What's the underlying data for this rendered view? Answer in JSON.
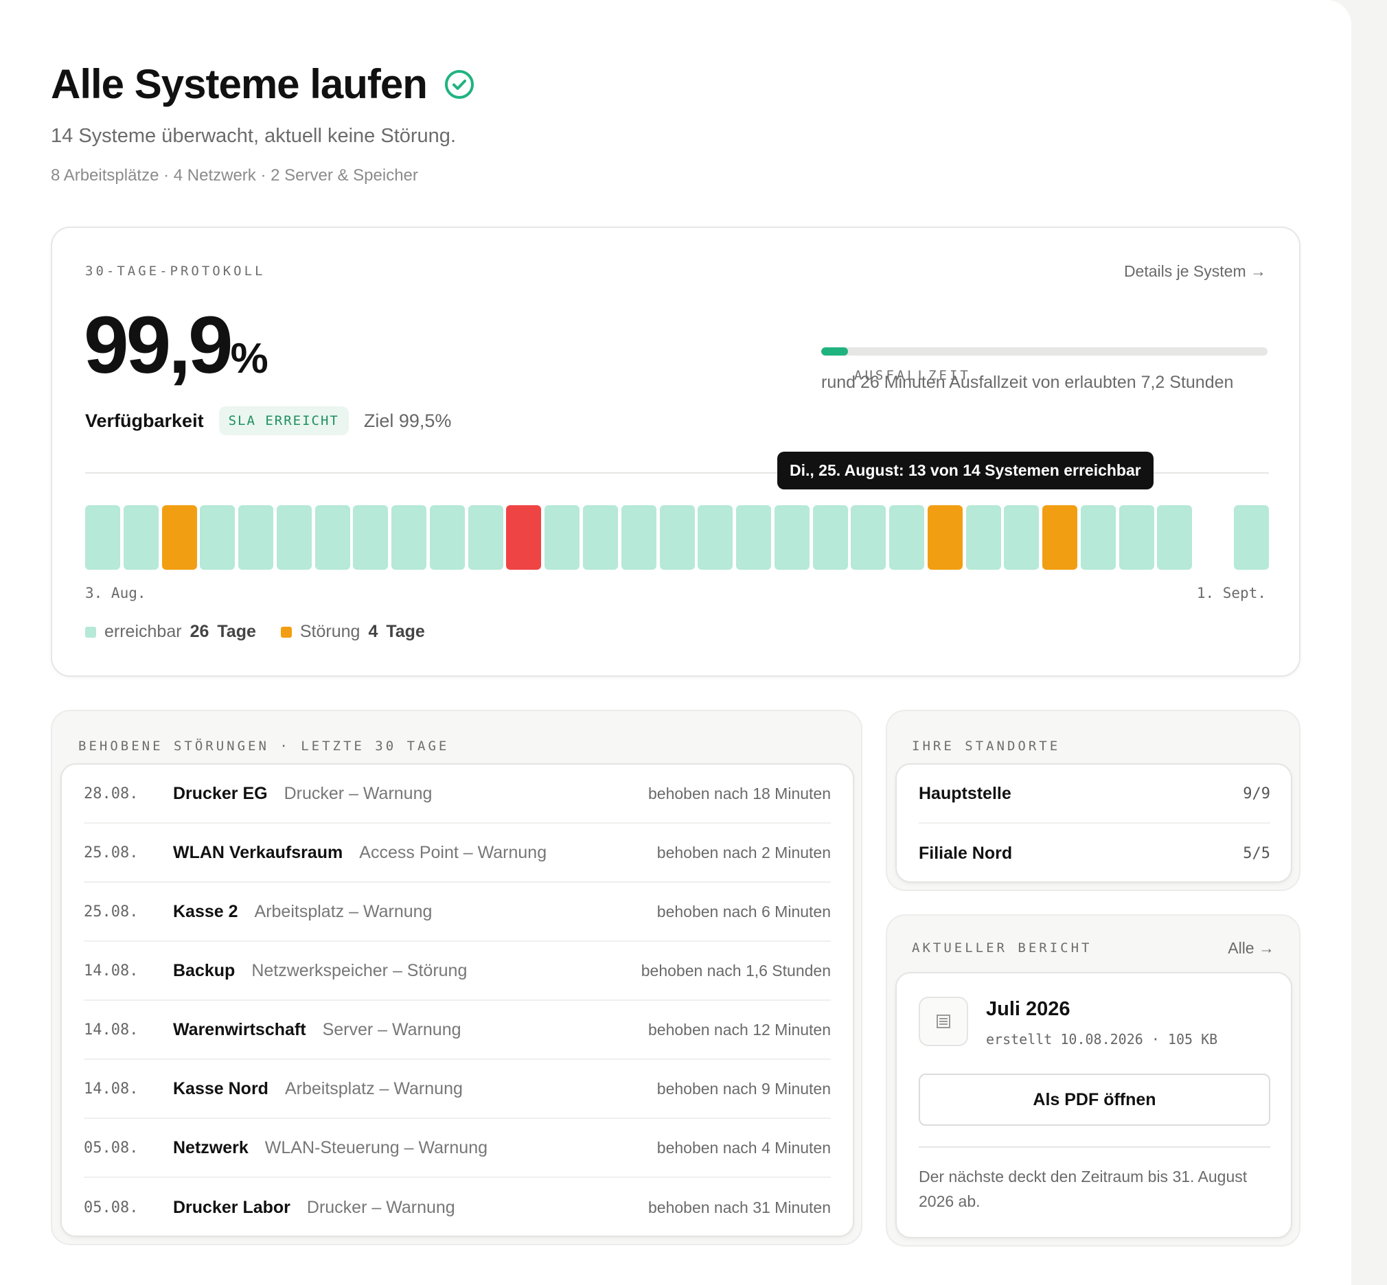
{
  "header": {
    "title": "Alle Systeme laufen",
    "subtitle": "14 Systeme überwacht, aktuell keine Störung.",
    "breakdown": "8 Arbeitsplätze · 4 Netzwerk · 2 Server & Speicher",
    "status_icon": "check-circle-icon"
  },
  "colors": {
    "accent_green": "#20b37f",
    "bar_ok": "#b6e9d7",
    "bar_warning": "#f29e12",
    "bar_outage": "#ef4444"
  },
  "protocol": {
    "eyebrow": "30-TAGE-PROTOKOLL",
    "details_link": "Details je System →",
    "availability_value": "99,9",
    "availability_unit": "%",
    "availability_label": "Verfügbarkeit",
    "sla_badge": "SLA ERREICHT",
    "target": "Ziel 99,5%",
    "downtime": {
      "label": "AUSFALLZEIT",
      "fraction": 0.06,
      "text": "rund 26 Minuten Ausfallzeit von erlaubten 7,2 Stunden"
    },
    "tooltip": "Di., 25. August: 13 von 14 Systemen erreichbar",
    "days": [
      "ok",
      "ok",
      "warning",
      "ok",
      "ok",
      "ok",
      "ok",
      "ok",
      "ok",
      "ok",
      "ok",
      "outage",
      "ok",
      "ok",
      "ok",
      "ok",
      "ok",
      "ok",
      "ok",
      "ok",
      "ok",
      "ok",
      "warning",
      "ok",
      "ok",
      "warning",
      "ok",
      "ok",
      "ok",
      "gap",
      "ok"
    ],
    "axis_start": "3. Aug.",
    "axis_end": "1. Sept.",
    "legend": {
      "ok_label": "erreichbar",
      "ok_count": "26",
      "ok_unit": "Tage",
      "issue_label": "Störung",
      "issue_count": "4",
      "issue_unit": "Tage"
    }
  },
  "incidents": {
    "eyebrow": "BEHOBENE STÖRUNGEN · LETZTE 30 TAGE",
    "rows": [
      {
        "date": "28.08.",
        "name": "Drucker EG",
        "type": "Drucker – Warnung",
        "resolved": "behoben nach 18 Minuten"
      },
      {
        "date": "25.08.",
        "name": "WLAN Verkaufsraum",
        "type": "Access Point – Warnung",
        "resolved": "behoben nach 2 Minuten"
      },
      {
        "date": "25.08.",
        "name": "Kasse 2",
        "type": "Arbeitsplatz – Warnung",
        "resolved": "behoben nach 6 Minuten"
      },
      {
        "date": "14.08.",
        "name": "Backup",
        "type": "Netzwerkspeicher – Störung",
        "resolved": "behoben nach 1,6 Stunden"
      },
      {
        "date": "14.08.",
        "name": "Warenwirtschaft",
        "type": "Server – Warnung",
        "resolved": "behoben nach 12 Minuten"
      },
      {
        "date": "14.08.",
        "name": "Kasse Nord",
        "type": "Arbeitsplatz – Warnung",
        "resolved": "behoben nach 9 Minuten"
      },
      {
        "date": "05.08.",
        "name": "Netzwerk",
        "type": "WLAN-Steuerung – Warnung",
        "resolved": "behoben nach 4 Minuten"
      },
      {
        "date": "05.08.",
        "name": "Drucker Labor",
        "type": "Drucker – Warnung",
        "resolved": "behoben nach 31 Minuten"
      }
    ]
  },
  "locations": {
    "eyebrow": "IHRE STANDORTE",
    "rows": [
      {
        "name": "Hauptstelle",
        "count": "9/9"
      },
      {
        "name": "Filiale Nord",
        "count": "5/5"
      }
    ]
  },
  "report": {
    "eyebrow": "AKTUELLER BERICHT",
    "all_link": "Alle →",
    "icon": "document-icon",
    "title": "Juli 2026",
    "meta": "erstellt 10.08.2026 · 105 KB",
    "button": "Als PDF öffnen",
    "note": "Der nächste deckt den Zeitraum bis 31. August 2026 ab."
  }
}
